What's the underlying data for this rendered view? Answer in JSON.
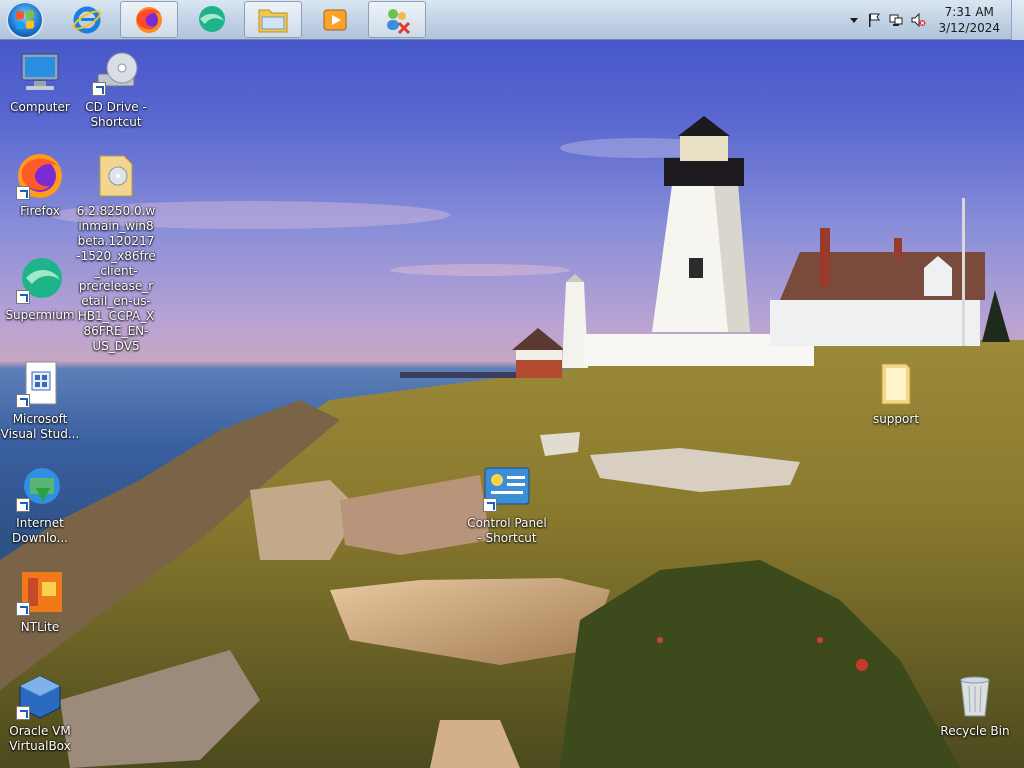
{
  "taskbar": {
    "start": {
      "icon": "windows-flag-icon"
    },
    "pinned": [
      {
        "name": "internet-explorer",
        "icon": "ie-icon",
        "active": false
      },
      {
        "name": "firefox",
        "icon": "firefox-icon",
        "active": true
      },
      {
        "name": "supermium",
        "icon": "supermium-icon",
        "active": false
      },
      {
        "name": "file-explorer",
        "icon": "folder-icon",
        "active": true
      },
      {
        "name": "media-player",
        "icon": "media-player-icon",
        "active": false
      },
      {
        "name": "user-accounts",
        "icon": "users-icon",
        "active": true
      }
    ],
    "tray": {
      "icons": [
        "chevron-up-icon",
        "action-center-flag-icon",
        "network-icon",
        "volume-muted-icon"
      ],
      "time": "7:31 AM",
      "date": "3/12/2024"
    }
  },
  "desktop": {
    "icons": [
      {
        "label": "Computer",
        "icon": "computer-icon",
        "shortcut": false
      },
      {
        "label": "CD Drive - Shortcut",
        "icon": "cd-drive-icon",
        "shortcut": true
      },
      {
        "label": "Firefox",
        "icon": "firefox-icon",
        "shortcut": true
      },
      {
        "label": "6.2.8250.0.winmain_win8beta.120217-1520_x86fre_client-prerelease_retail_en-us-HB1_CCPA_X86FRE_EN-US_DV5",
        "icon": "folder-disc-icon",
        "shortcut": false
      },
      {
        "label": "Supermium",
        "icon": "supermium-icon",
        "shortcut": true
      },
      {
        "label": "Microsoft Visual Stud...",
        "icon": "visual-studio-icon",
        "shortcut": true
      },
      {
        "label": "Internet Downlo...",
        "icon": "internet-download-manager-icon",
        "shortcut": true
      },
      {
        "label": "NTLite",
        "icon": "ntlite-icon",
        "shortcut": true
      },
      {
        "label": "Oracle VM VirtualBox",
        "icon": "virtualbox-icon",
        "shortcut": true
      },
      {
        "label": "Control Panel - Shortcut",
        "icon": "control-panel-icon",
        "shortcut": true
      },
      {
        "label": "support",
        "icon": "folder-icon",
        "shortcut": false
      },
      {
        "label": "Recycle Bin",
        "icon": "recycle-bin-icon",
        "shortcut": false
      }
    ]
  },
  "colors": {
    "taskbar": "#c3d3e6",
    "sky_top": "#3e4fc6",
    "sea": "#2f5285",
    "grass": "#8a7a30"
  }
}
